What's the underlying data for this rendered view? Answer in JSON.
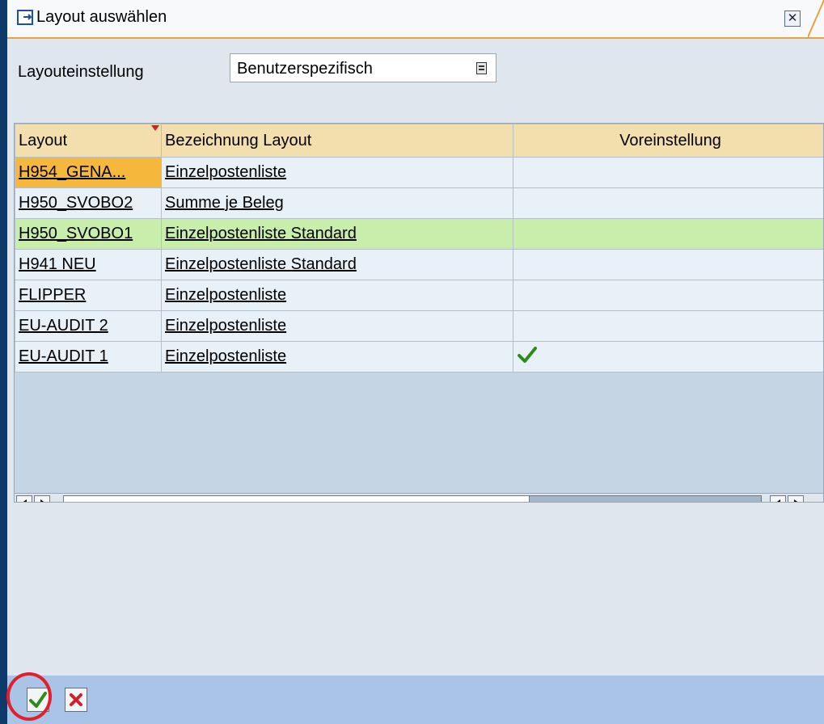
{
  "dialog": {
    "title": "Layout auswählen",
    "close_icon": "close-icon"
  },
  "setting": {
    "label": "Layouteinstellung",
    "value": "Benutzerspezifisch"
  },
  "table": {
    "columns": [
      "Layout",
      "Bezeichnung Layout",
      "Voreinstellung"
    ],
    "rows": [
      {
        "layout": "H954_GENA...",
        "bezeichnung": "Einzelpostenliste",
        "voreinstellung": ""
      },
      {
        "layout": "H950_SVOBO2",
        "bezeichnung": "Summe je Beleg",
        "voreinstellung": ""
      },
      {
        "layout": "H950_SVOBO1",
        "bezeichnung": "Einzelpostenliste Standard",
        "voreinstellung": ""
      },
      {
        "layout": "H941 NEU",
        "bezeichnung": "Einzelpostenliste Standard",
        "voreinstellung": ""
      },
      {
        "layout": "FLIPPER",
        "bezeichnung": "Einzelpostenliste",
        "voreinstellung": ""
      },
      {
        "layout": "EU-AUDIT 2",
        "bezeichnung": "Einzelpostenliste",
        "voreinstellung": ""
      },
      {
        "layout": "EU-AUDIT 1",
        "bezeichnung": "Einzelpostenliste",
        "voreinstellung": "check-icon"
      }
    ],
    "selected_row": 0,
    "highlighted_row": 2
  },
  "colors": {
    "header_bg": "#f3dfae",
    "selected_cell": "#f6b83c",
    "highlight_row": "#c7eeaa",
    "footer_bg": "#a9c4e6",
    "accent_circle": "#e0202a"
  },
  "footer": {
    "confirm_icon": "check-icon",
    "cancel_icon": "cancel-x-icon"
  }
}
